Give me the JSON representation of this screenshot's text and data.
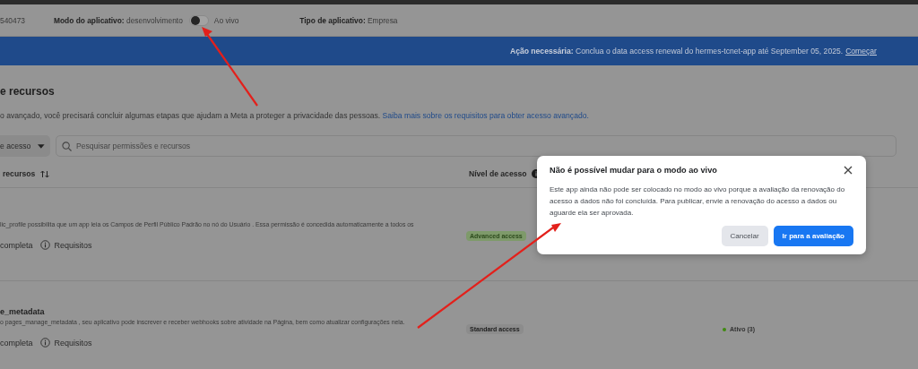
{
  "header": {
    "app_id": "540473",
    "mode_label": "Modo do aplicativo:",
    "mode_value": "desenvolvimento",
    "live_toggle": {
      "on": false
    },
    "live_label": "Ao vivo",
    "type_label": "Tipo de aplicativo:",
    "type_value": "Empresa"
  },
  "banner": {
    "text": "**Ação necessária:** Conclua o data access renewal do hermes-tcnet-app até September 05, 2025.",
    "link": "Começar"
  },
  "section": {
    "title": "e recursos",
    "description": "o avançado, você precisará concluir algumas etapas que ajudam a Meta a proteger a privacidade das pessoas.",
    "link": "Saiba mais sobre os requisitos para obter acesso avançado."
  },
  "filter": {
    "dropdown": "e acesso",
    "search_placeholder": "Pesquisar permissões e recursos"
  },
  "table": {
    "columns": [
      "recursos",
      "Nível de acesso"
    ],
    "rows": [
      {
        "description": "lic_profile possibilita que um app leia os Campos de Perfil Público Padrão no nó do Usuário . Essa permissão é concedida automaticamente a todos os",
        "access": {
          "label": "Advanced access",
          "kind": "advanced"
        },
        "links": [
          "completa",
          "Requisitos"
        ]
      },
      {
        "name": "e_metadata",
        "description": "o pages_manage_metadata , seu aplicativo pode inscrever e receber webhooks sobre atividade na Página, bem como atualizar configurações nela.",
        "access": {
          "label": "Standard access",
          "kind": "standard"
        },
        "status": {
          "label": "Ativo (3)",
          "color": "#3f8a10"
        },
        "links": [
          "completa",
          "Requisitos"
        ]
      }
    ]
  },
  "modal": {
    "title": "Não é possível mudar para o modo ao vivo",
    "body": "Este app ainda não pode ser colocado no modo ao vivo porque a avaliação da renovação do acesso a dados não foi concluída. Para publicar, envie a renovação do acesso a dados ou aguarde ela ser aprovada.",
    "buttons": [
      {
        "label": "Cancelar",
        "kind": "secondary"
      },
      {
        "label": "Ir para a avaliação",
        "kind": "primary"
      }
    ]
  }
}
